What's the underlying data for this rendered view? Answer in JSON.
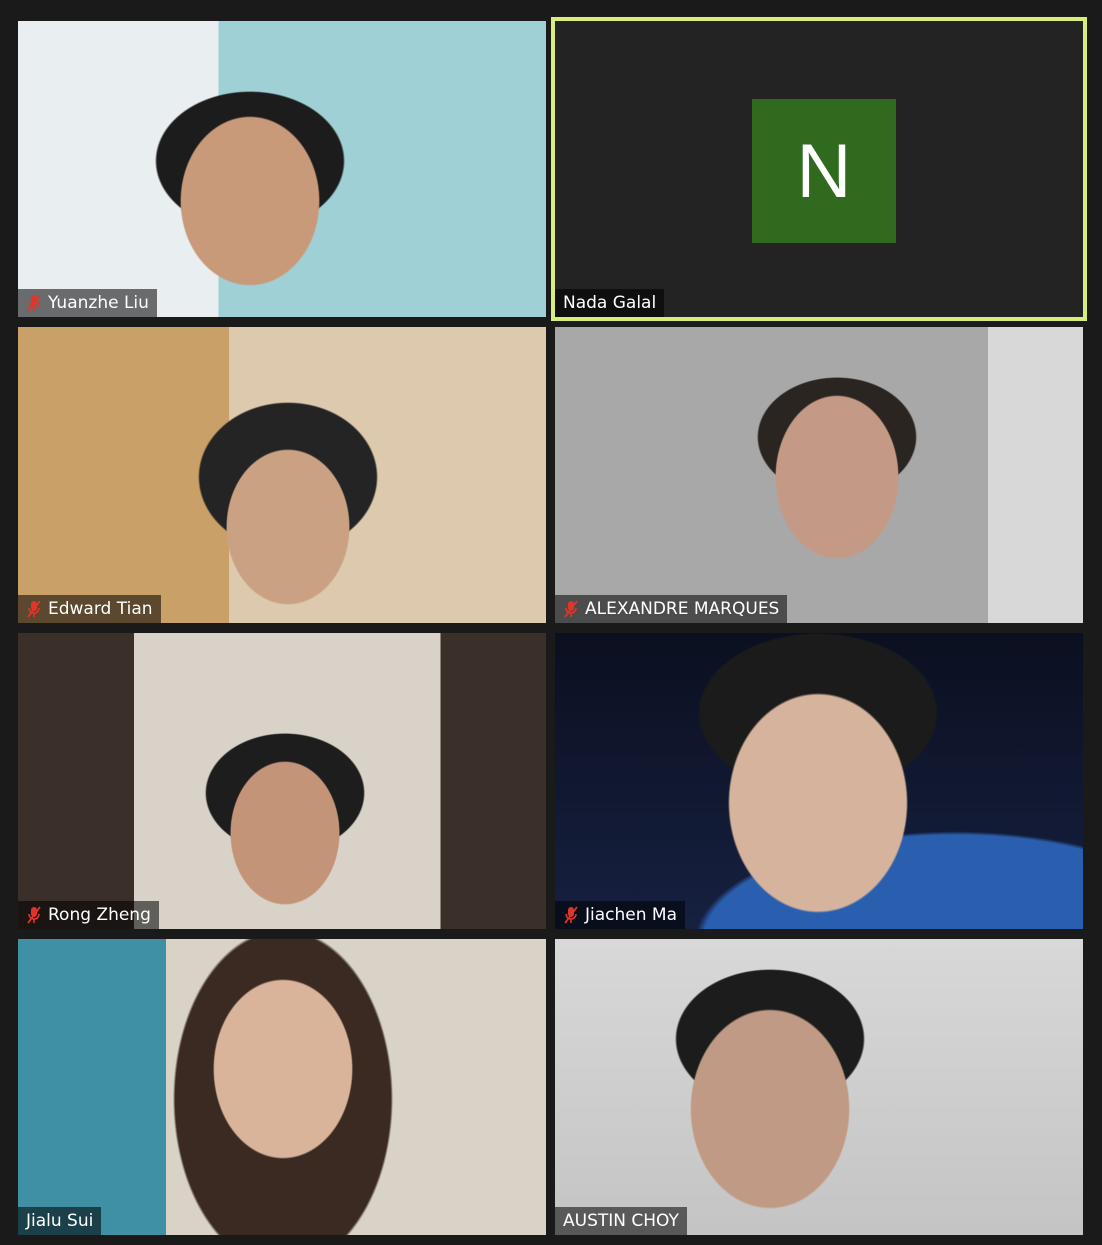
{
  "meeting": {
    "participants": [
      {
        "name": "Yuanzhe Liu",
        "muted": true,
        "video_on": true,
        "active_speaker": false
      },
      {
        "name": "Nada Galal",
        "muted": false,
        "video_on": false,
        "active_speaker": true,
        "avatar_initial": "N",
        "avatar_color": "#2f6a1e"
      },
      {
        "name": "Edward Tian",
        "muted": true,
        "video_on": true,
        "active_speaker": false
      },
      {
        "name": "ALEXANDRE MARQUES",
        "muted": true,
        "video_on": true,
        "active_speaker": false
      },
      {
        "name": "Rong Zheng",
        "muted": true,
        "video_on": true,
        "active_speaker": false
      },
      {
        "name": "Jiachen Ma",
        "muted": true,
        "video_on": true,
        "active_speaker": false
      },
      {
        "name": "Jialu Sui",
        "muted": false,
        "video_on": true,
        "active_speaker": false
      },
      {
        "name": "AUSTIN CHOY",
        "muted": false,
        "video_on": true,
        "active_speaker": false
      }
    ],
    "colors": {
      "background": "#1a1a1a",
      "active_speaker_border": "#d7ef7a",
      "muted_icon": "#e0352b"
    }
  }
}
